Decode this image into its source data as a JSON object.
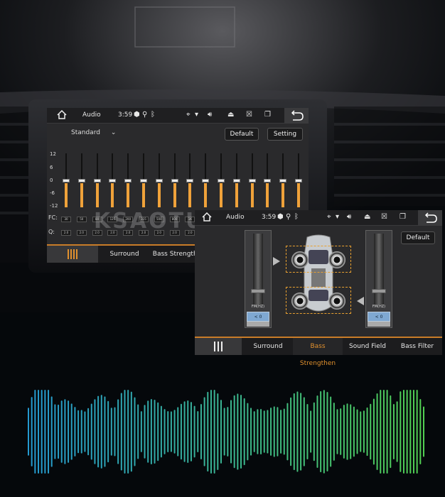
{
  "watermark": "KSAOTU",
  "eq_screen": {
    "title": "Audio",
    "time": "3:59",
    "preset": "Standard",
    "default_label": "Default",
    "setting_label": "Setting",
    "y_ticks": [
      "12",
      "6",
      "0",
      "-6",
      "-12"
    ],
    "fc_label": "FC:",
    "q_label": "Q:",
    "fc_values": [
      "30",
      "50",
      "80",
      "125",
      "200",
      "315",
      "500",
      "800",
      "1K",
      "1.6K",
      "2.5K",
      "4K",
      "6K",
      "10K",
      "12K",
      "16K"
    ],
    "q_values": [
      "2.0",
      "2.0",
      "2.0",
      "2.0",
      "2.0",
      "2.0",
      "2.0",
      "2.0",
      "2.0",
      "2.0",
      "2.0",
      "2.0",
      "2.0",
      "2.0",
      "2.0",
      "2.0"
    ],
    "band_levels_db": [
      0,
      0,
      0,
      0,
      0,
      0,
      0,
      0,
      0,
      0,
      0,
      0,
      0,
      0,
      0,
      0
    ],
    "tabs": {
      "surround": "Surround",
      "bass": "Bass Strengthe"
    }
  },
  "bass_screen": {
    "title": "Audio",
    "time": "3:59",
    "default_label": "Default",
    "fm_label": "FM(HZ)",
    "left_value": "0",
    "right_value": "0",
    "tabs": {
      "surround": "Surround",
      "bass": "Bass Strengthen",
      "sound_field": "Sound Field",
      "bass_filter": "Bass Filter"
    }
  },
  "colors": {
    "accent": "#e0902e",
    "slider_fill": "#f0a23a"
  }
}
